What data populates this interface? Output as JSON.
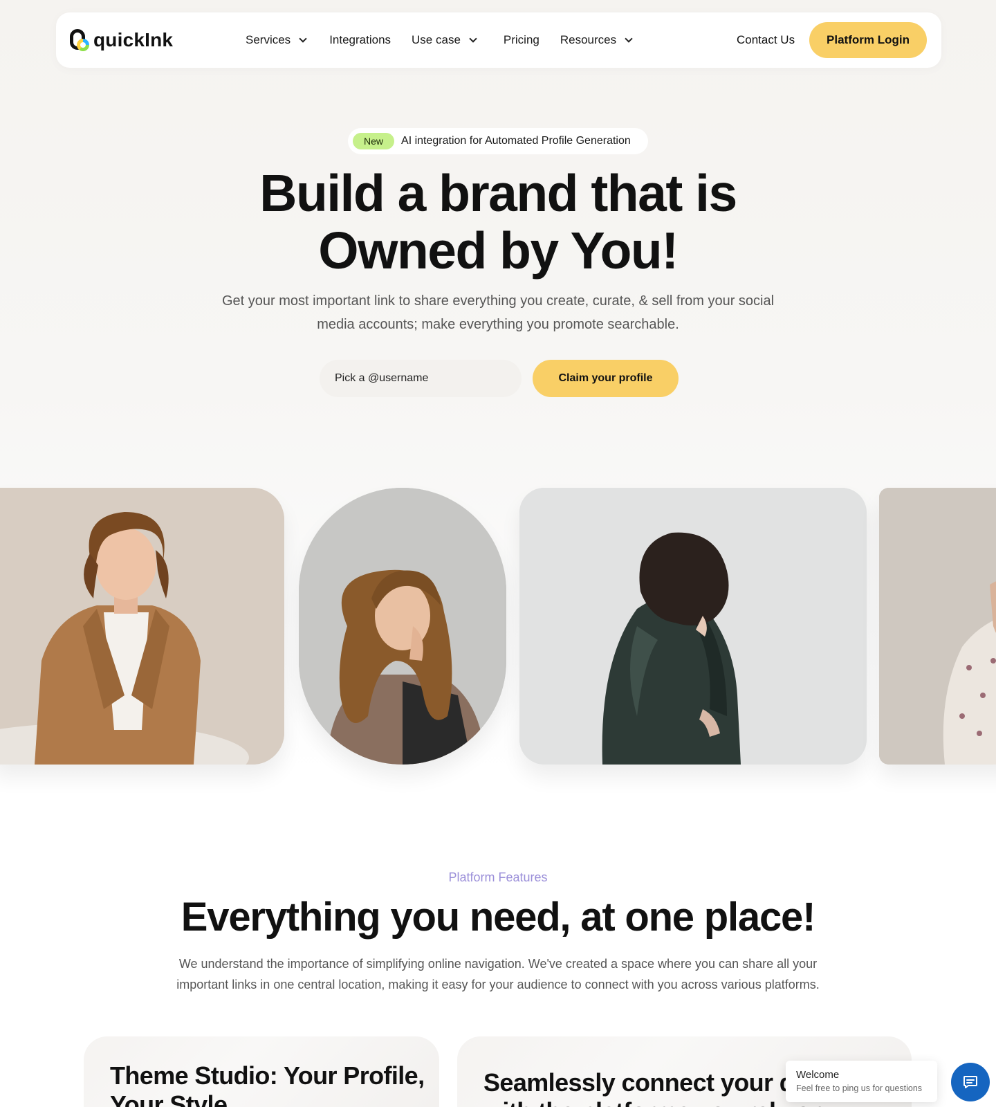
{
  "brand": {
    "name": "quickInk",
    "accent": "#f9cf66",
    "new_badge_color": "#c6f08b",
    "eyebrow_color": "#9b8fd9",
    "chat_color": "#1565c0"
  },
  "nav": {
    "items": [
      {
        "label": "Services",
        "dropdown": true
      },
      {
        "label": "Integrations",
        "dropdown": false
      },
      {
        "label": "Use case",
        "dropdown": true
      },
      {
        "label": "Pricing",
        "dropdown": false
      },
      {
        "label": "Resources",
        "dropdown": true
      }
    ],
    "contact_label": "Contact Us",
    "login_label": "Platform Login"
  },
  "hero": {
    "badge_new": "New",
    "badge_text": "AI integration for Automated Profile Generation",
    "title_line1": "Build a brand that is",
    "title_line2": "Owned by You!",
    "subtitle": "Get your most important link to share everything you create, curate, & sell from your social media accounts; make everything you promote searchable.",
    "username_placeholder": "Pick a @username",
    "claim_label": "Claim your profile"
  },
  "gallery": [
    {
      "icon": "person-man-tan-blazer"
    },
    {
      "icon": "person-woman-curly-hair"
    },
    {
      "icon": "person-woman-leather-jacket"
    },
    {
      "icon": "person-woman-floral-dress"
    }
  ],
  "features": {
    "eyebrow": "Platform Features",
    "title": "Everything you need, at one place!",
    "subtitle": "We understand the importance of simplifying online navigation. We've created a space where you can share all your important links in one central location, making it easy for your audience to connect with you across various platforms.",
    "card1_title_line1": "Theme Studio: Your Profile,",
    "card1_title_line2": "Your Style",
    "card2_title_line1": "Seamlessly connect your qu",
    "card2_title_line2": "with the platforms you rely on"
  },
  "chat": {
    "title": "Welcome",
    "text": "Feel free to ping us for questions",
    "icon": "chat-icon"
  }
}
